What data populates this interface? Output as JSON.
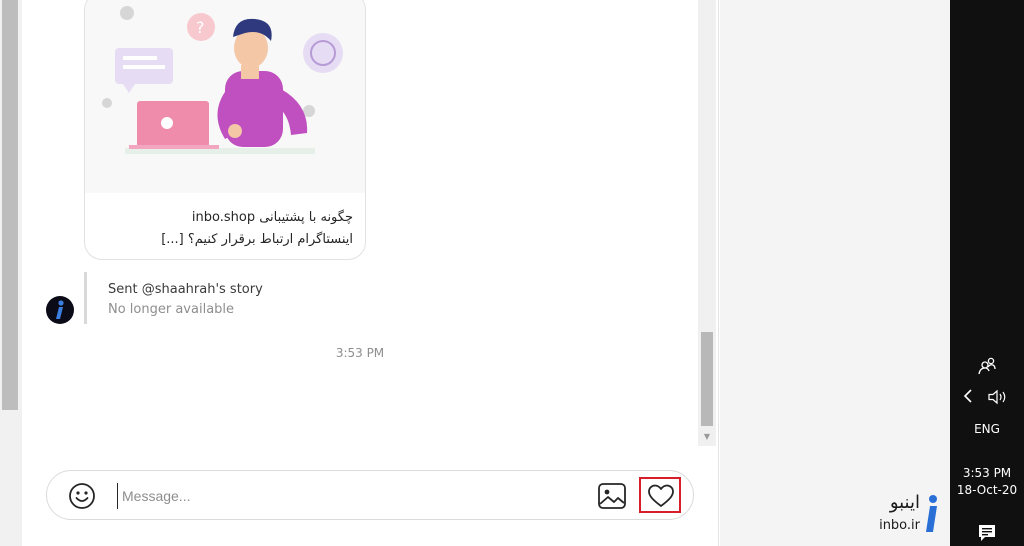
{
  "link_card": {
    "title": "چگونه با پشتیبانی inbo.shop",
    "description": "اینستاگرام ارتباط برقرار کنیم؟ [...]"
  },
  "story_reply": {
    "sent_text": "Sent @shaahrah's story",
    "status_text": "No longer available"
  },
  "timestamp": "3:53 PM",
  "composer": {
    "placeholder": "Message...",
    "value": ""
  },
  "icons": {
    "emoji": "emoji-icon",
    "image": "image-icon",
    "heart": "heart-icon"
  },
  "colors": {
    "highlight": "#d81e2a",
    "taskbar": "#101010"
  },
  "taskbar": {
    "language": "ENG",
    "time": "3:53 PM",
    "date": "18-Oct-20"
  },
  "watermark": {
    "name_fa": "اینبو",
    "domain": "inbo.ir"
  }
}
